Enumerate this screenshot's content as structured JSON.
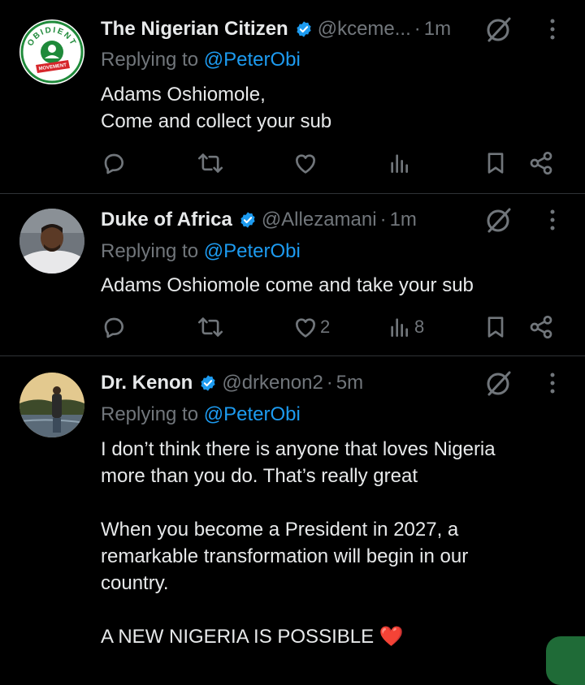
{
  "tweets": [
    {
      "name": "The Nigerian Citizen",
      "handle": "@kceme...",
      "separator": "·",
      "time": "1m",
      "replying_prefix": "Replying to",
      "replying_to": "@PeterObi",
      "text_lines": [
        "Adams Oshiomole,",
        "Come and collect your sub"
      ],
      "avatar": {
        "type": "logo",
        "logo_text_top": "OBIDIENT",
        "logo_text_bottom": "MOVEMENT",
        "colors": {
          "ring": "#1f8a3a",
          "bg": "#ffffff",
          "banner": "#d6262b"
        }
      },
      "stats": {
        "replies": "",
        "reposts": "",
        "likes": "",
        "views": ""
      }
    },
    {
      "name": "Duke of Africa",
      "handle": "@Allezamani",
      "separator": "·",
      "time": "1m",
      "replying_prefix": "Replying to",
      "replying_to": "@PeterObi",
      "text_lines": [
        "Adams Oshiomole come and take your sub"
      ],
      "avatar": {
        "type": "photo"
      },
      "stats": {
        "replies": "",
        "reposts": "",
        "likes": "2",
        "views": "8"
      }
    },
    {
      "name": "Dr. Kenon",
      "handle": "@drkenon2",
      "separator": "·",
      "time": "5m",
      "replying_prefix": "Replying to",
      "replying_to": "@PeterObi",
      "text_lines": [
        "I don’t think there is anyone that loves Nigeria",
        "more than you do. That’s really great",
        "",
        "When you become a President in 2027, a",
        "remarkable transformation will begin in our",
        "country.",
        "",
        "A NEW NIGERIA IS POSSIBLE"
      ],
      "emoji": "❤️",
      "avatar": {
        "type": "photo"
      }
    }
  ],
  "icons": {
    "verified": "verified-badge-icon",
    "grok": "grok-icon",
    "more": "more-vertical-icon",
    "reply": "reply-icon",
    "repost": "repost-icon",
    "like": "heart-icon",
    "views": "views-icon",
    "bookmark": "bookmark-icon",
    "share": "share-icon"
  },
  "colors": {
    "background": "#000000",
    "text": "#e7e9ea",
    "muted": "#71767b",
    "accent": "#1d9bf0",
    "divider": "#2f3336",
    "heart": "#f4212e"
  }
}
